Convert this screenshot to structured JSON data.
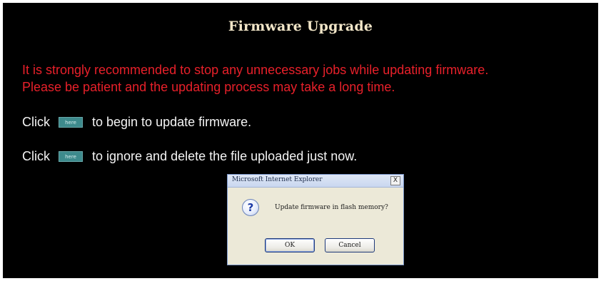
{
  "page": {
    "title": "Firmware Upgrade",
    "warning_lines": [
      "It is strongly recommended to stop any unnecessary jobs while updating firmware.",
      "Please be patient and the updating process may take a long time."
    ],
    "actions": [
      {
        "prefix": "Click",
        "button_label": "here",
        "suffix": "to begin to update firmware."
      },
      {
        "prefix": "Click",
        "button_label": "here",
        "suffix": "to ignore and delete the file uploaded just now."
      }
    ]
  },
  "dialog": {
    "title": "Microsoft Internet Explorer",
    "close_label": "X",
    "icon": "question-icon",
    "icon_glyph": "?",
    "message": "Update firmware in flash memory?",
    "ok_label": "OK",
    "cancel_label": "Cancel"
  },
  "colors": {
    "background": "#000000",
    "title": "#f2e6c8",
    "warning": "#e8202a",
    "text": "#f4f4f4",
    "here_button": "#3d8a8c"
  }
}
